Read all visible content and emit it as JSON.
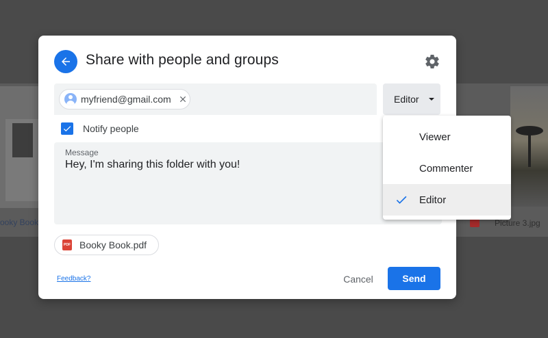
{
  "background": {
    "left_caption": "ooky Book",
    "right_caption": "Picture 3.jpg"
  },
  "dialog": {
    "title": "Share with people and groups",
    "back_icon": "arrow-left-icon",
    "settings_icon": "gear-icon",
    "recipient_chip": {
      "email": "myfriend@gmail.com"
    },
    "role_button": {
      "label": "Editor"
    },
    "notify": {
      "label": "Notify people",
      "checked": true
    },
    "message": {
      "label": "Message",
      "text": "Hey, I'm sharing this folder with you!"
    },
    "attachment": {
      "name": "Booky Book.pdf",
      "icon_text": "PDF"
    },
    "footer": {
      "feedback": "Feedback?",
      "cancel": "Cancel",
      "send": "Send"
    }
  },
  "role_menu": {
    "items": [
      {
        "label": "Viewer",
        "selected": false
      },
      {
        "label": "Commenter",
        "selected": false
      },
      {
        "label": "Editor",
        "selected": true
      }
    ]
  },
  "colors": {
    "accent": "#1a73e8",
    "pdf": "#db4437"
  }
}
